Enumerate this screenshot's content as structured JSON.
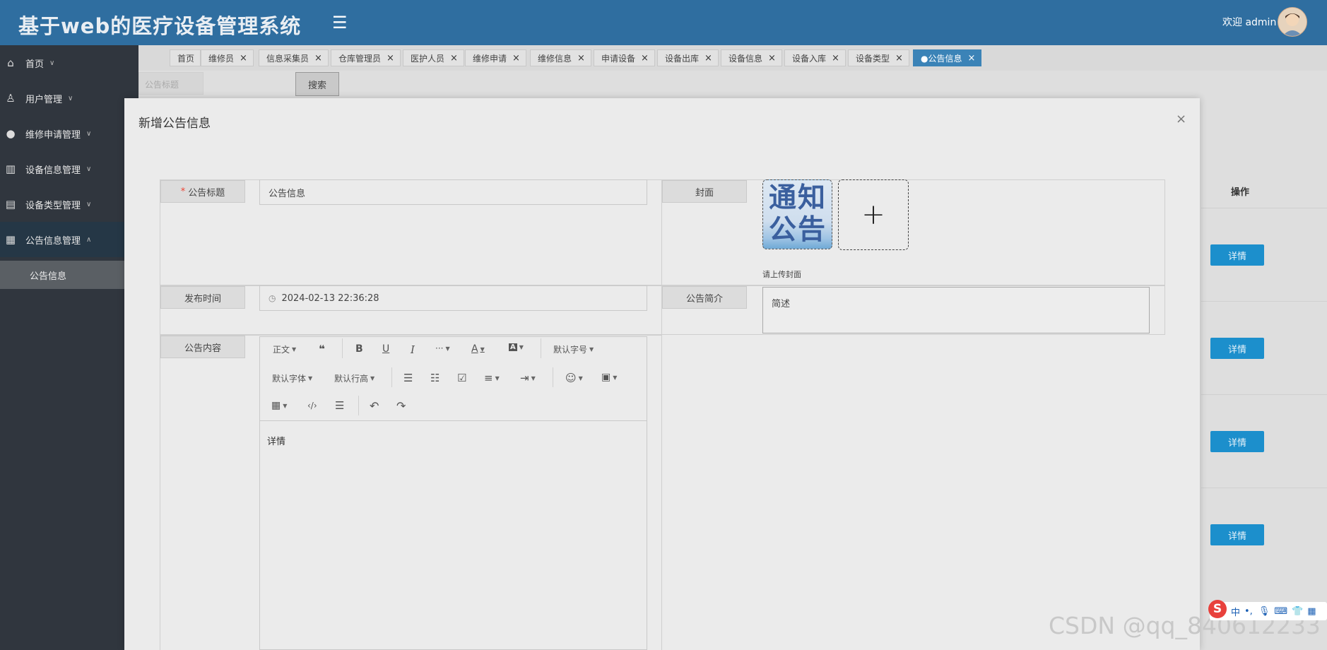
{
  "header": {
    "title": "基于web的医疗设备管理系统",
    "welcome": "欢迎 admin"
  },
  "sidebar": {
    "items": [
      {
        "label": "首页",
        "icon": "home-icon"
      },
      {
        "label": "用户管理",
        "icon": "user-icon"
      },
      {
        "label": "维修申请管理",
        "icon": "mouse-icon"
      },
      {
        "label": "设备信息管理",
        "icon": "columns-icon"
      },
      {
        "label": "设备类型管理",
        "icon": "layout-icon"
      },
      {
        "label": "公告信息管理",
        "icon": "grid-icon"
      }
    ],
    "sub_item": "公告信息"
  },
  "tabs": [
    "首页",
    "维修员",
    "信息采集员",
    "仓库管理员",
    "医护人员",
    "维修申请",
    "维修信息",
    "申请设备",
    "设备出库",
    "设备信息",
    "设备入库",
    "设备类型",
    "●公告信息"
  ],
  "list": {
    "search_placeholder": "公告标题",
    "search_button": "搜索",
    "col_ops": "操作",
    "detail_label": "详情"
  },
  "modal": {
    "title": "新增公告信息",
    "close": "×",
    "fields": {
      "title_label": "公告标题",
      "title_value": "公告信息",
      "cover_label": "封面",
      "cover_image_text": "通知公告",
      "upload_hint": "请上传封面",
      "publish_label": "发布时间",
      "publish_value": "2024-02-13 22:36:28",
      "summary_label": "公告简介",
      "summary_value": "简述",
      "content_label": "公告内容"
    },
    "editor": {
      "paragraph": "正文",
      "font_size": "默认字号",
      "font_family": "默认字体",
      "line_height": "默认行高",
      "body_text": "详情"
    }
  },
  "watermark": "CSDN @qq_840612233",
  "ime": "中"
}
